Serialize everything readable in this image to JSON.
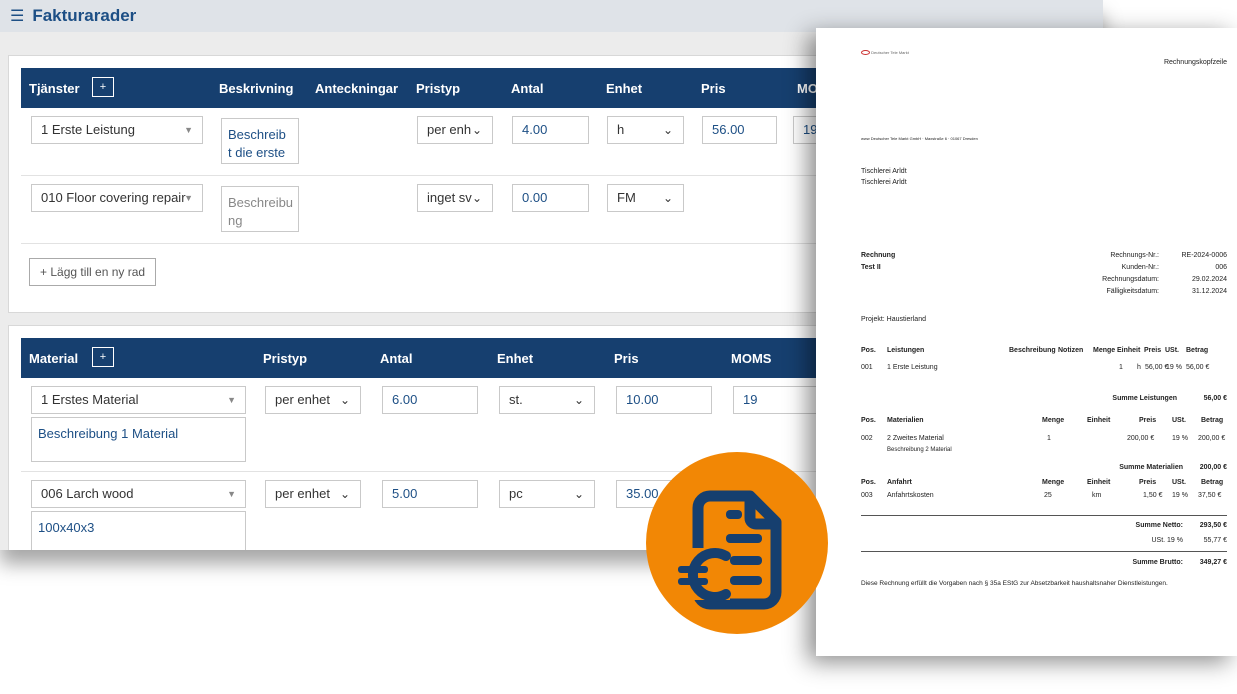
{
  "header": {
    "menu_icon": "hamburger-icon",
    "title": "Fakturarader"
  },
  "services": {
    "title": "Tjänster",
    "add_label": "+",
    "columns": [
      "Beskrivning",
      "Anteckningar",
      "Pristyp",
      "Antal",
      "Enhet",
      "Pris",
      "MO"
    ],
    "rows": [
      {
        "item": "1 Erste Leistung",
        "description": "Beschreib t die erste",
        "price_type": "per enh",
        "quantity": "4.00",
        "unit": "h",
        "price": "56.00",
        "vat": "19"
      },
      {
        "item": "010 Floor covering repair",
        "description": "Beschreibu ng",
        "price_type": "inget sv",
        "quantity": "0.00",
        "unit": "FM",
        "price": "",
        "vat": ""
      }
    ],
    "add_row_label": "+  Lägg till en ny rad"
  },
  "material": {
    "title": "Material",
    "add_label": "+",
    "columns": [
      "Pristyp",
      "Antal",
      "Enhet",
      "Pris",
      "MOMS"
    ],
    "rows": [
      {
        "item": "1 Erstes Material",
        "description": "Beschreibung 1 Material",
        "price_type": "per enhet",
        "quantity": "6.00",
        "unit": "st.",
        "price": "10.00",
        "vat": "19"
      },
      {
        "item": "006 Larch wood",
        "description": "100x40x3",
        "price_type": "per enhet",
        "quantity": "5.00",
        "unit": "pc",
        "price": "35.00",
        "vat": ""
      }
    ]
  },
  "invoice": {
    "logo_text": "Deutscher Tele Markt",
    "header_label": "Rechnungskopfzeile",
    "sender_line": "www Deutscher Tele Markt GmbH · Maxstraße 6 · 01067 Dresden",
    "recipient": [
      "Tischlerei Arldt",
      "Tischlerei Arldt"
    ],
    "doc_title": "Rechnung",
    "doc_subtitle": "Test II",
    "meta": [
      {
        "label": "Rechnungs-Nr.:",
        "value": "RE-2024-0006"
      },
      {
        "label": "Kunden-Nr.:",
        "value": "006"
      },
      {
        "label": "Rechnungsdatum:",
        "value": "29.02.2024"
      },
      {
        "label": "Fälligkeitsdatum:",
        "value": "31.12.2024"
      }
    ],
    "project": "Projekt: Haustierland",
    "services_head": [
      "Pos.",
      "Leistungen",
      "Beschreibung",
      "Notizen",
      "Menge",
      "Einheit",
      "Preis",
      "USt.",
      "Betrag"
    ],
    "services_row": [
      "001",
      "1 Erste Leistung",
      "1",
      "h",
      "56,00 €",
      "19 %",
      "56,00 €"
    ],
    "services_sum": {
      "label": "Summe Leistungen",
      "value": "56,00 €"
    },
    "materials_head": [
      "Pos.",
      "Materialien",
      "Menge",
      "Einheit",
      "Preis",
      "USt.",
      "Betrag"
    ],
    "materials_row": [
      "002",
      "2 Zweites Material",
      "1",
      "200,00 €",
      "19 %",
      "200,00 €"
    ],
    "materials_row_desc": "Beschreibung 2 Material",
    "materials_sum": {
      "label": "Summe Materialien",
      "value": "200,00 €"
    },
    "travel_head": [
      "Pos.",
      "Anfahrt",
      "Menge",
      "Einheit",
      "Preis",
      "USt.",
      "Betrag"
    ],
    "travel_row": [
      "003",
      "Anfahrtskosten",
      "25",
      "km",
      "1,50 €",
      "19 %",
      "37,50 €"
    ],
    "net": {
      "label": "Summe Netto:",
      "value": "293,50 €"
    },
    "tax": {
      "label": "USt. 19 %",
      "value": "55,77 €"
    },
    "gross": {
      "label": "Summe Brutto:",
      "value": "349,27 €"
    },
    "footer_note": "Diese Rechnung erfüllt die Vorgaben nach § 35a EStG zur Absetzbarkeit haushaltsnaher Dienstleistungen."
  },
  "badge": {
    "icon": "invoice-euro-icon",
    "color": "#f28705"
  }
}
